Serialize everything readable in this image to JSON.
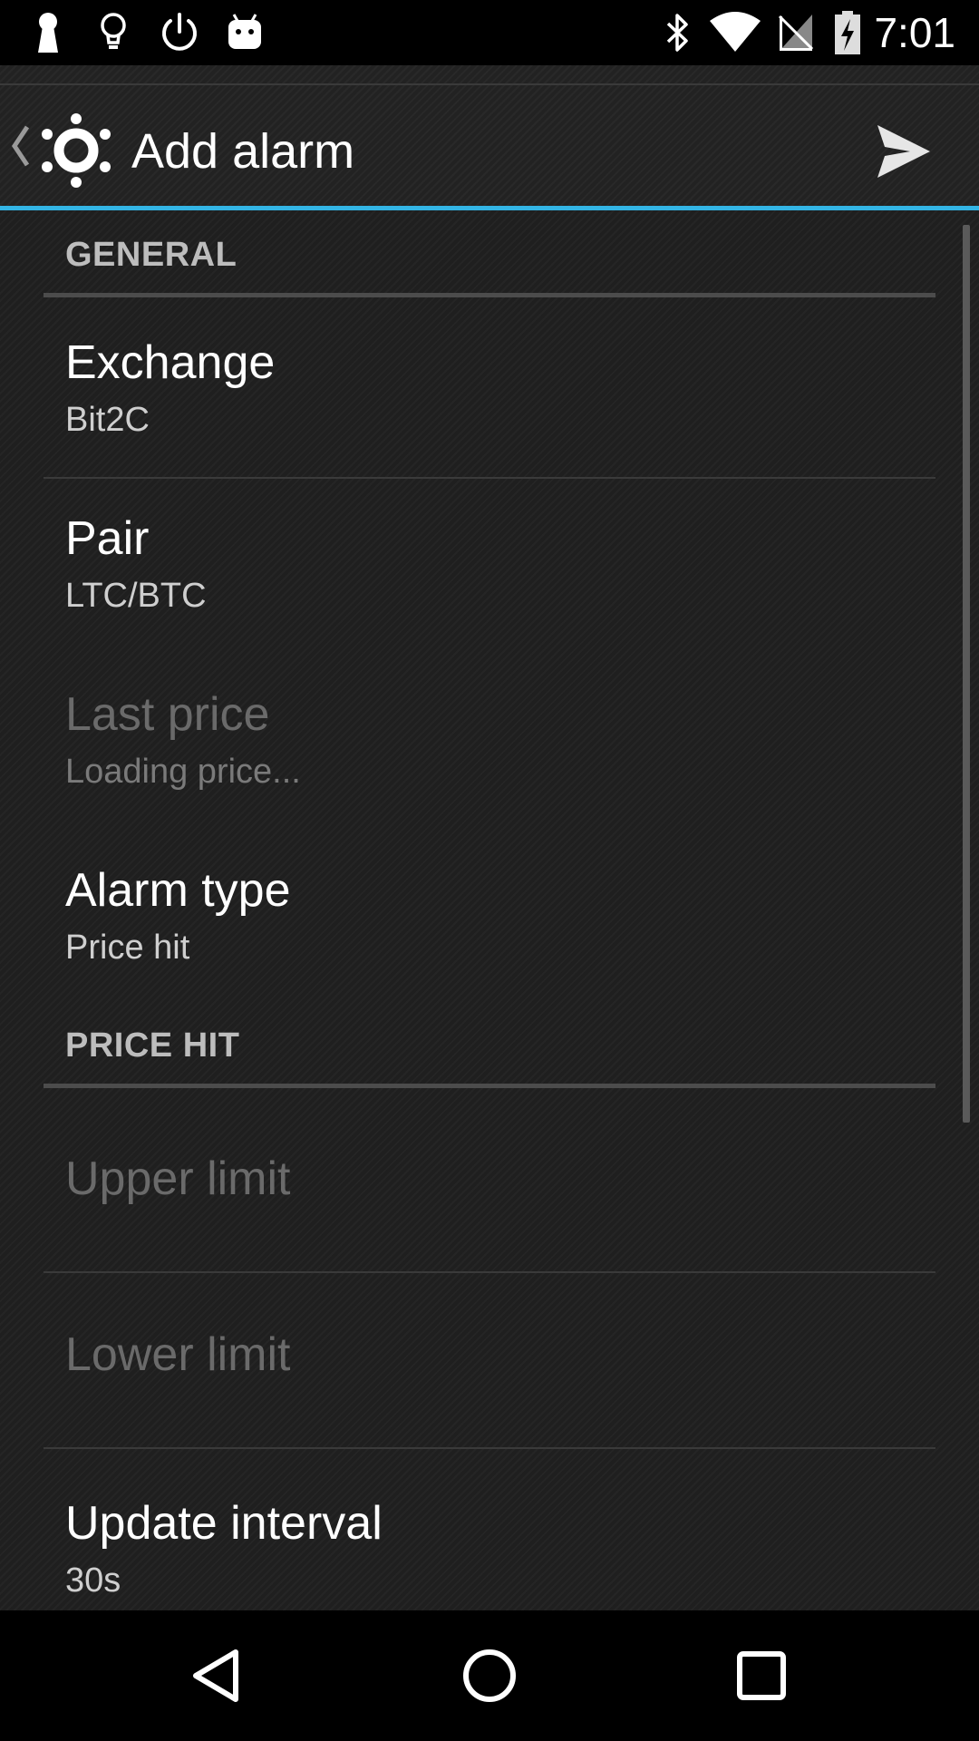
{
  "status_bar": {
    "time": "7:01",
    "left_icons": [
      "keyhole-icon",
      "lightbulb-icon",
      "power-icon",
      "android-robot-icon"
    ],
    "right_icons": [
      "bluetooth-icon",
      "wifi-icon",
      "no-signal-icon",
      "battery-charging-icon"
    ]
  },
  "app_bar": {
    "title": "Add alarm",
    "accent_color": "#33b5e5",
    "up_icon": "chevron-left-icon",
    "logo_icon": "app-logo-icon",
    "action_icon": "send-icon"
  },
  "sections": {
    "general": {
      "header": "GENERAL",
      "exchange": {
        "title": "Exchange",
        "summary": "Bit2C"
      },
      "pair": {
        "title": "Pair",
        "summary": "LTC/BTC"
      },
      "last_price": {
        "title": "Last price",
        "summary": "Loading price..."
      },
      "alarm_type": {
        "title": "Alarm type",
        "summary": "Price hit"
      }
    },
    "price_hit": {
      "header": "PRICE HIT",
      "upper_limit": {
        "title": "Upper limit"
      },
      "lower_limit": {
        "title": "Lower limit"
      },
      "update_interval": {
        "title": "Update interval",
        "summary": "30s"
      }
    }
  },
  "nav_bar": {
    "back_icon": "nav-back-icon",
    "home_icon": "nav-home-icon",
    "recents_icon": "nav-recents-icon"
  }
}
